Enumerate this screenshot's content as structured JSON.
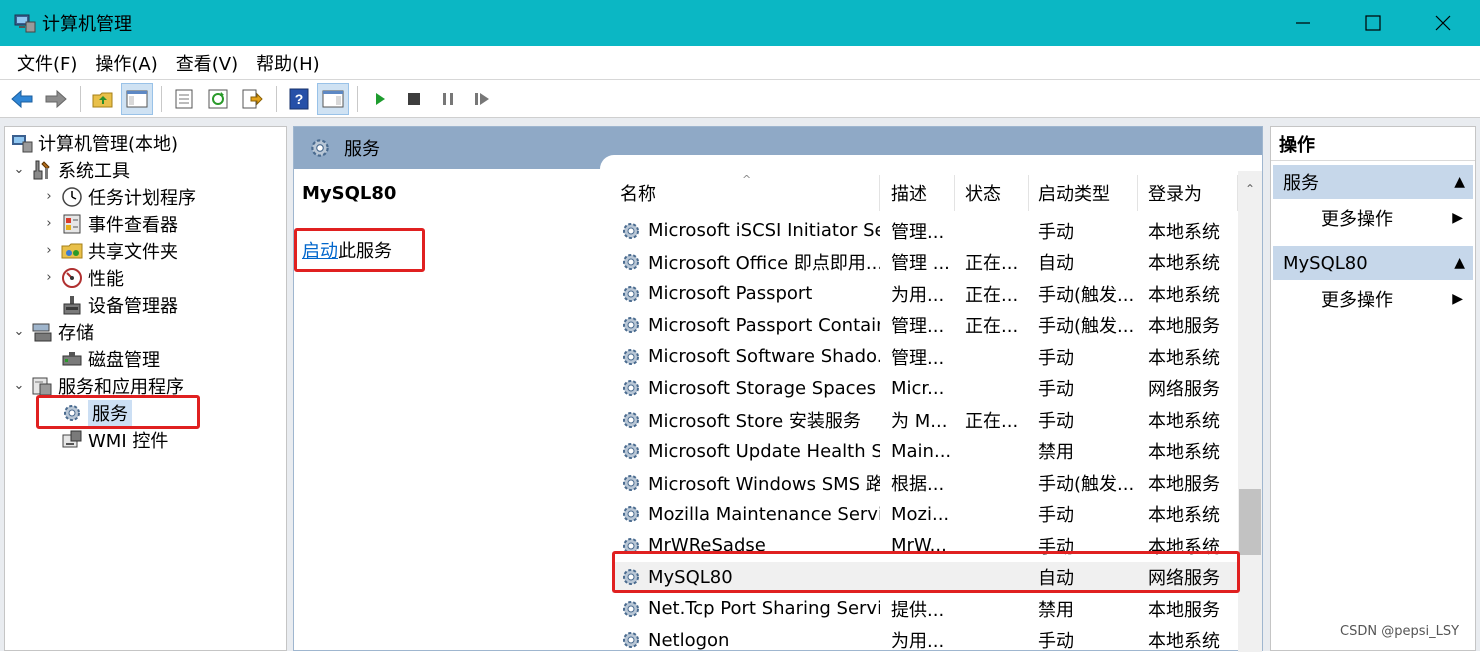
{
  "window": {
    "title": "计算机管理"
  },
  "menubar": [
    "文件(F)",
    "操作(A)",
    "查看(V)",
    "帮助(H)"
  ],
  "toolbar": {
    "buttons": [
      "back-icon",
      "forward-icon",
      "up-folder-icon",
      "show-hide-tree-icon",
      "properties-icon",
      "refresh-icon",
      "export-icon",
      "help-icon",
      "show-hide-action-icon",
      "start-icon",
      "stop-icon",
      "pause-icon",
      "resume-icon"
    ]
  },
  "tree": {
    "root": "计算机管理(本地)",
    "items": [
      {
        "label": "系统工具"
      },
      {
        "label": "任务计划程序"
      },
      {
        "label": "事件查看器"
      },
      {
        "label": "共享文件夹"
      },
      {
        "label": "性能"
      },
      {
        "label": "设备管理器"
      },
      {
        "label": "存储"
      },
      {
        "label": "磁盘管理"
      },
      {
        "label": "服务和应用程序"
      },
      {
        "label": "服务"
      },
      {
        "label": "WMI 控件"
      }
    ]
  },
  "center": {
    "header": "服务",
    "selected_service": "MySQL80",
    "start_link": "启动",
    "start_suffix": "此服务",
    "columns": [
      "名称",
      "描述",
      "状态",
      "启动类型",
      "登录为"
    ],
    "rows": [
      [
        "Microsoft iSCSI Initiator Ser...",
        "管理...",
        "",
        "手动",
        "本地系统"
      ],
      [
        "Microsoft Office 即点即用...",
        "管理 ...",
        "正在...",
        "自动",
        "本地系统"
      ],
      [
        "Microsoft Passport",
        "为用...",
        "正在...",
        "手动(触发...",
        "本地系统"
      ],
      [
        "Microsoft Passport Container",
        "管理...",
        "正在...",
        "手动(触发...",
        "本地服务"
      ],
      [
        "Microsoft Software Shado...",
        "管理...",
        "",
        "手动",
        "本地系统"
      ],
      [
        "Microsoft Storage Spaces S...",
        "Micr...",
        "",
        "手动",
        "网络服务"
      ],
      [
        "Microsoft Store 安装服务",
        "为 M...",
        "正在...",
        "手动",
        "本地系统"
      ],
      [
        "Microsoft Update Health S...",
        "Main...",
        "",
        "禁用",
        "本地系统"
      ],
      [
        "Microsoft Windows SMS 路...",
        "根据...",
        "",
        "手动(触发...",
        "本地服务"
      ],
      [
        "Mozilla Maintenance Service",
        "Mozi...",
        "",
        "手动",
        "本地系统"
      ],
      [
        "MrWReSadse",
        "MrW...",
        "",
        "手动",
        "本地系统"
      ],
      [
        "MySQL80",
        "",
        "",
        "自动",
        "网络服务"
      ],
      [
        "Net.Tcp Port Sharing Service",
        "提供...",
        "",
        "禁用",
        "本地服务"
      ],
      [
        "Netlogon",
        "为用...",
        "",
        "手动",
        "本地系统"
      ]
    ]
  },
  "actions": {
    "title": "操作",
    "sections": [
      {
        "label": "服务",
        "item": "更多操作"
      },
      {
        "label": "MySQL80",
        "item": "更多操作"
      }
    ]
  },
  "watermark": "CSDN @pepsi_LSY"
}
